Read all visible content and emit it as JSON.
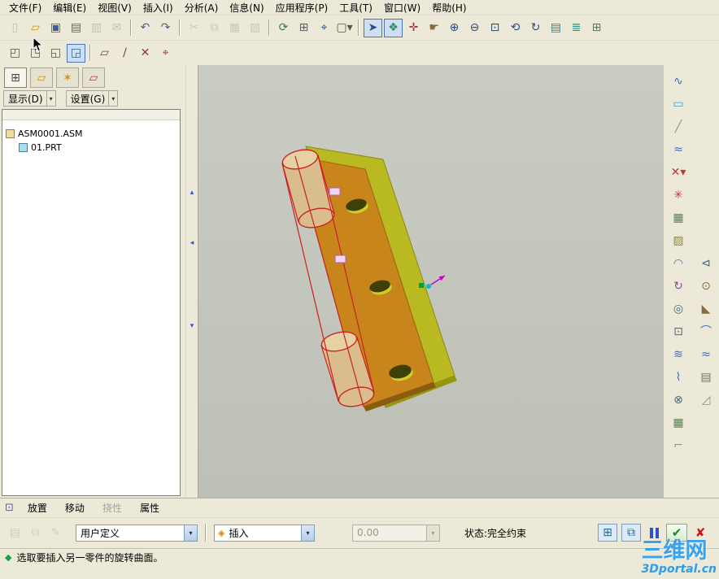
{
  "ui": {
    "dropdown_arrow": "▾"
  },
  "colors": {
    "window_bg": "#ece9d8",
    "viewport_bg_top": "#c8ccc2",
    "viewport_bg_bottom": "#bcc0b6",
    "active_button_bg": "#cfdef0",
    "watermark_blue": "#1e96f0",
    "prompt_green": "#18a048"
  },
  "menu": {
    "items": [
      {
        "n": "menu-file",
        "label": "文件(F)"
      },
      {
        "n": "menu-edit",
        "label": "编辑(E)"
      },
      {
        "n": "menu-view",
        "label": "视图(V)"
      },
      {
        "n": "menu-insert",
        "label": "插入(I)"
      },
      {
        "n": "menu-analysis",
        "label": "分析(A)"
      },
      {
        "n": "menu-info",
        "label": "信息(N)"
      },
      {
        "n": "menu-applications",
        "label": "应用程序(P)"
      },
      {
        "n": "menu-tools",
        "label": "工具(T)"
      },
      {
        "n": "menu-window",
        "label": "窗口(W)"
      },
      {
        "n": "menu-help",
        "label": "帮助(H)"
      }
    ]
  },
  "toolbar_main": {
    "buttons": [
      {
        "n": "new-file-button",
        "g": "▯",
        "c": "#888888",
        "cls": "disabled"
      },
      {
        "n": "open-file-button",
        "g": "▱",
        "c": "#c8960a"
      },
      {
        "n": "save-file-button",
        "g": "▣",
        "c": "#3a5f9e"
      },
      {
        "n": "print-button",
        "g": "▤",
        "c": "#666666"
      },
      {
        "n": "print-preview-button",
        "g": "▥",
        "c": "#888888",
        "cls": "disabled"
      },
      {
        "n": "send-mail-button",
        "g": "✉",
        "c": "#888888",
        "cls": "disabled"
      },
      {
        "n": "separator",
        "cls": "sep"
      },
      {
        "n": "undo-button",
        "g": "↶",
        "c": "#555c88"
      },
      {
        "n": "redo-button",
        "g": "↷",
        "c": "#555c88"
      },
      {
        "n": "separator",
        "cls": "sep"
      },
      {
        "n": "cut-button",
        "g": "✂",
        "c": "#999999",
        "cls": "disabled"
      },
      {
        "n": "copy-button",
        "g": "⧉",
        "c": "#999999",
        "cls": "disabled"
      },
      {
        "n": "paste-button",
        "g": "▦",
        "c": "#999999",
        "cls": "disabled"
      },
      {
        "n": "paste-special-button",
        "g": "▧",
        "c": "#999999",
        "cls": "disabled"
      },
      {
        "n": "separator",
        "cls": "sep"
      },
      {
        "n": "regenerate-button",
        "g": "⟳",
        "c": "#3a7a3a"
      },
      {
        "n": "copy-geometry-button",
        "g": "⊞",
        "c": "#555c88"
      },
      {
        "n": "find-button",
        "g": "⌖",
        "c": "#2a4a8a"
      },
      {
        "n": "selection-filter-button",
        "g": "▢▾",
        "c": "#555555"
      },
      {
        "n": "separator",
        "cls": "sep"
      },
      {
        "n": "select-items-button",
        "g": "➤",
        "c": "#2a4a8a",
        "cls": "active"
      },
      {
        "n": "select-box-button",
        "g": "❖",
        "c": "#2a8a6a",
        "cls": "active"
      },
      {
        "n": "spin-center-button",
        "g": "✛",
        "c": "#a03030"
      },
      {
        "n": "pan-button",
        "g": "☛",
        "c": "#8a6a3a"
      },
      {
        "n": "zoom-in-button",
        "g": "⊕",
        "c": "#2a4a8a"
      },
      {
        "n": "zoom-out-button",
        "g": "⊖",
        "c": "#2a4a8a"
      },
      {
        "n": "zoom-fit-button",
        "g": "⊡",
        "c": "#2a4a8a"
      },
      {
        "n": "repaint-button",
        "g": "⟲",
        "c": "#2a4a8a"
      },
      {
        "n": "reorient-button",
        "g": "↻",
        "c": "#2a4a8a"
      },
      {
        "n": "saved-views-button",
        "g": "▤",
        "c": "#2a8a8a"
      },
      {
        "n": "layers-button",
        "g": "≣",
        "c": "#2a8a8a"
      },
      {
        "n": "view-manager-button",
        "g": "⊞",
        "c": "#2a8a8a"
      }
    ]
  },
  "toolbar_second": {
    "buttons": [
      {
        "n": "window-tile-button",
        "g": "◰",
        "c": "#555555"
      },
      {
        "n": "window-cascade-button",
        "g": "◳",
        "c": "#555555"
      },
      {
        "n": "window-close-button",
        "g": "◱",
        "c": "#555555"
      },
      {
        "n": "window-activate-button",
        "g": "◲",
        "c": "#2a6a8a",
        "cls": "active"
      },
      {
        "n": "separator",
        "cls": "sep"
      },
      {
        "n": "datum-plane-button",
        "g": "▱",
        "c": "#8a3a3a"
      },
      {
        "n": "datum-axis-button",
        "g": "∕",
        "c": "#8a3a3a"
      },
      {
        "n": "datum-point-button",
        "g": "✕",
        "c": "#8a3a3a"
      },
      {
        "n": "datum-csys-button",
        "g": "⌖",
        "c": "#8a3a3a"
      }
    ]
  },
  "navigator": {
    "tabs": [
      {
        "n": "model-tree-tab",
        "g": "⊞",
        "c": "#444444",
        "cls": "active"
      },
      {
        "n": "folder-browser-tab",
        "g": "▱",
        "c": "#c8960a"
      },
      {
        "n": "favorites-tab",
        "g": "✶",
        "c": "#c8960a"
      },
      {
        "n": "connections-tab",
        "g": "▱",
        "c": "#a04040"
      }
    ],
    "show_button": "显示(D)",
    "settings_button": "设置(G)",
    "tree": [
      {
        "n": "tree-item-asm0001",
        "label": "ASM0001.ASM",
        "pad": "4px",
        "icon": "icon-asm",
        "icon_name": "assembly-icon"
      },
      {
        "n": "tree-item-01prt",
        "label": "01.PRT",
        "pad": "20px",
        "icon": "icon-prt",
        "icon_name": "part-icon"
      }
    ]
  },
  "sash": {
    "handles": [
      {
        "n": "sash-collapse-up",
        "g": "▴"
      },
      {
        "n": "sash-collapse-left",
        "g": "◂"
      },
      {
        "n": "sash-collapse-down",
        "g": "▾"
      }
    ]
  },
  "toolbar_right": {
    "col1": [
      {
        "n": "style-tool-button",
        "g": "∿",
        "c": "#3a6ebf"
      },
      {
        "n": "rectangle-tool-button",
        "g": "▭",
        "c": "#3aa0c8"
      },
      {
        "n": "line-tool-button",
        "g": "╱",
        "c": "#909090"
      },
      {
        "n": "spline-tool-button",
        "g": "≈",
        "c": "#3a6ebf"
      },
      {
        "n": "point-tool-button",
        "g": "✕▾",
        "c": "#c03a3a"
      },
      {
        "n": "point-star-tool-button",
        "g": "✳",
        "c": "#c03a3a"
      },
      {
        "n": "pattern-tool-button",
        "g": "▦",
        "c": "#4a8a4a"
      },
      {
        "n": "hatch-tool-button",
        "g": "▨",
        "c": "#8a8a3a"
      },
      {
        "n": "arc-tool-button",
        "g": "◠",
        "c": "#3a6ebf"
      },
      {
        "n": "rotate-tool-button",
        "g": "↻",
        "c": "#8a4a8a"
      },
      {
        "n": "offset-tool-button",
        "g": "◎",
        "c": "#4a6a8a"
      },
      {
        "n": "project-tool-button",
        "g": "⊡",
        "c": "#4a6a8a"
      },
      {
        "n": "wrap-tool-button",
        "g": "≋",
        "c": "#3a6ebf"
      },
      {
        "n": "curve-tool-button",
        "g": "⌇",
        "c": "#3a6ebf"
      },
      {
        "n": "intersect-tool-button",
        "g": "⊗",
        "c": "#4a6a8a"
      },
      {
        "n": "grid-tool-button",
        "g": "▦",
        "c": "#4a8a4a"
      },
      {
        "n": "corner-tool-button",
        "g": "⌐",
        "c": "#909090"
      }
    ],
    "col2": [
      {
        "n": "mirror-tool-button",
        "g": "⊲",
        "c": "#4a6a8a"
      },
      {
        "n": "round-tool-button",
        "g": "⊙",
        "c": "#8a6a3a"
      },
      {
        "n": "chamfer-tool-button",
        "g": "◣",
        "c": "#8a6a3a"
      },
      {
        "n": "arc-segment-tool-button",
        "g": "⌒",
        "c": "#3a6ebf"
      },
      {
        "n": "wave-tool-button",
        "g": "≈",
        "c": "#3a6ebf"
      },
      {
        "n": "table-tool-button",
        "g": "▤",
        "c": "#4a8a4a"
      },
      {
        "n": "triangle-tool-button",
        "g": "◿",
        "c": "#909090"
      }
    ]
  },
  "model": {
    "colors": {
      "plate": "#c8851c",
      "plate_edge": "#9a6410",
      "plate_side": "#8a5c12",
      "back_plate": "#b9b922",
      "back_edge": "#8a8a12",
      "back_side": "#96960f",
      "knuckle": "#d9bd8c",
      "knuckle_top": "#e7d0a4",
      "wire": "#cc2020",
      "hole": "#3f3f08",
      "hole_glow": "#cfcf28",
      "handle_fill": "#f2d5ee",
      "handle_stroke": "#b060b0",
      "marker_green": "#00a040",
      "marker_cyan": "#00bfbf",
      "marker_magenta": "#c800c8"
    }
  },
  "dashboard": {
    "panel_icon": "⊡",
    "tabs": [
      {
        "n": "dashboard-tab-placement",
        "label": "放置"
      },
      {
        "n": "dashboard-tab-move",
        "label": "移动"
      },
      {
        "n": "dashboard-tab-flexibility",
        "label": "挠性",
        "cls": "disabled"
      },
      {
        "n": "dashboard-tab-properties",
        "label": "属性"
      }
    ],
    "left_buttons": [
      {
        "n": "placement-page-button",
        "g": "▤",
        "c": "#a8a498",
        "cls": "disabled"
      },
      {
        "n": "placement-copy-button",
        "g": "⧉",
        "c": "#a8a498",
        "cls": "disabled"
      },
      {
        "n": "placement-edit-button",
        "g": "✎",
        "c": "#a8a498",
        "cls": "disabled"
      }
    ],
    "preset_combo": {
      "value": "用户定义"
    },
    "constraint_combo": {
      "value": "插入",
      "icon_glyph": "◈"
    },
    "offset_combo": {
      "value": "0.00"
    },
    "status_text": "状态:完全约束",
    "right_buttons": [
      {
        "n": "preview-window-toggle",
        "g": "⊞",
        "c": "#2a6a8a"
      },
      {
        "n": "model-window-toggle",
        "g": "⧉",
        "c": "#2a6a8a"
      }
    ],
    "ok_glyph": "✔",
    "cancel_glyph": "✘"
  },
  "statusbar": {
    "icon_glyph": "◆",
    "message": "选取要插入另一零件的旋转曲面。"
  },
  "watermark": {
    "line1": "三维网",
    "line2": "3Dportal.cn"
  }
}
